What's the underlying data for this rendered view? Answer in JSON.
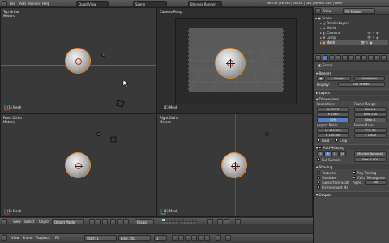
{
  "topbar": {
    "menus": [
      "File",
      "Add",
      "Render",
      "Help"
    ],
    "layout": "Quad View",
    "scene": "Scene",
    "engine": "Blender Render",
    "stats": "Ve:730 | Fa:740 | Ob:3-1 | La:1 | Mem:1.45M | Mesh",
    "view_label": "View",
    "all_scenes": "All Scenes"
  },
  "viewports": {
    "top_left": {
      "title": "Top Ortho",
      "units": "Meters",
      "object": "(1) Mesh"
    },
    "top_right": {
      "title": "Camera Persp",
      "object": "(1) Mesh"
    },
    "bottom_left": {
      "title": "Front Ortho",
      "units": "Meters",
      "object": "(1) Mesh"
    },
    "bottom_right": {
      "title": "Right Ortho",
      "units": "Meters",
      "object": "(1) Mesh"
    }
  },
  "header3d": {
    "menus": [
      "View",
      "Select",
      "Object"
    ],
    "mode": "Object Mode",
    "pivot": "Global"
  },
  "timeline": {
    "menus": [
      "View",
      "Frame",
      "Playback"
    ],
    "pr": "PR",
    "start": "Start: 1",
    "end": "End: 250",
    "current": "1"
  },
  "outliner": {
    "rows": [
      "Scene",
      "RenderLayers",
      "World",
      "Camera",
      "Lamp",
      "Mesh"
    ]
  },
  "properties": {
    "scene_label": "Scene",
    "render_header": "Render",
    "render_btns": [
      "Image",
      "Animation"
    ],
    "display_label": "Display:",
    "display_value": "Full Screen",
    "layers_header": "Layers",
    "dimensions_header": "Dimensions",
    "resolution_label": "Resolution:",
    "res_x": "X: 1920",
    "res_y": "Y: 1080",
    "res_pct": "50%",
    "frame_range_label": "Frame Range:",
    "start": "Start: 1",
    "end": "End: 250",
    "step": "Step: 1",
    "aspect_label": "Aspect Ratio:",
    "asp_x": "X: 100.000",
    "asp_y": "Y: 100.000",
    "fps_label": "Frame Rate:",
    "fps": "FPS: 24",
    "time": "/: 1.000",
    "border": "Bord",
    "crop": "Crop",
    "aa_header": "Anti-Aliasing",
    "aa_samples": [
      "5",
      "8",
      "11",
      "16"
    ],
    "aa_filter": "Mitchell-Netravali",
    "full_sample": "Full Sample",
    "aa_size": "Size: 1.000",
    "shading_header": "Shading",
    "textures": "Textures",
    "ray_tracing": "Ray Tracing",
    "shadows": "Shadows",
    "color_mgmt": "Color Manageme",
    "sss": "Subsurface Scatt",
    "alpha_label": "Alpha:",
    "alpha_value": "Sky",
    "env_map": "Environment Ma",
    "output_header": "Output"
  },
  "colors": {
    "selection": "#e78a2a",
    "x_axis": "#b8322f",
    "y_axis": "#4a7a3a",
    "accent_blue": "#5680c2"
  }
}
